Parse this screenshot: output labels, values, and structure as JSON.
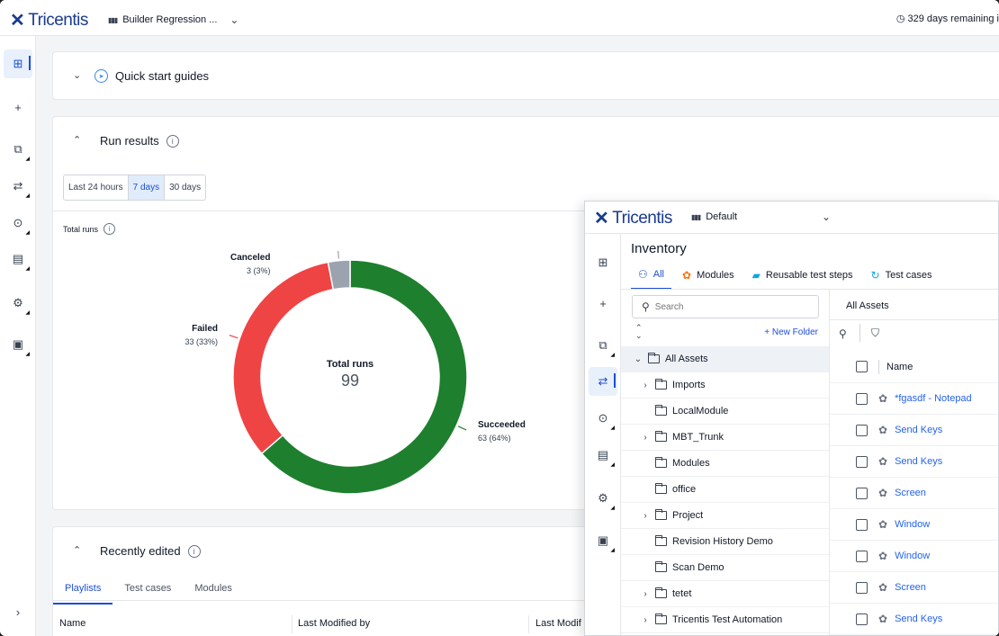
{
  "back": {
    "brand": "Tricentis",
    "workspace": "Builder Regression ...",
    "workspace_icon": "org-icon",
    "remaining": "329 days remaining i",
    "quick_start": "Quick start guides",
    "run_results": {
      "title": "Run results",
      "ranges": [
        "Last 24 hours",
        "7 days",
        "30 days"
      ],
      "selected_range": "7 days",
      "total_runs_label": "Total runs"
    },
    "recently_edited": {
      "title": "Recently edited",
      "tabs": [
        "Playlists",
        "Test cases",
        "Modules"
      ],
      "selected_tab": "Playlists",
      "columns": [
        "Name",
        "Last Modified by",
        "Last Modif"
      ]
    }
  },
  "chart_data": {
    "type": "pie",
    "variant": "donut",
    "center_title": "Total runs",
    "center_value": "99",
    "slices": [
      {
        "label": "Succeeded",
        "value": 63,
        "percent": "63 (64%)",
        "color": "#1e7f2e"
      },
      {
        "label": "Failed",
        "value": 33,
        "percent": "33 (33%)",
        "color": "#ef4444"
      },
      {
        "label": "Canceled",
        "value": 3,
        "percent": "3 (3%)",
        "color": "#9ca3af"
      }
    ]
  },
  "front": {
    "brand": "Tricentis",
    "workspace": "Default",
    "title": "Inventory",
    "categories": [
      {
        "label": "All",
        "icon": "all-assets-icon",
        "color": "#1d4ed8"
      },
      {
        "label": "Modules",
        "icon": "module-icon",
        "color": "#f97316"
      },
      {
        "label": "Reusable test steps",
        "icon": "folder-icon",
        "color": "#0ea5e9"
      },
      {
        "label": "Test cases",
        "icon": "refresh-icon",
        "color": "#0ea5e9"
      }
    ],
    "search_placeholder": "Search",
    "new_folder": "+ New Folder",
    "tree": [
      {
        "label": "All Assets",
        "expander": "down",
        "root": true
      },
      {
        "label": "Imports",
        "expander": "right"
      },
      {
        "label": "LocalModule",
        "expander": ""
      },
      {
        "label": "MBT_Trunk",
        "expander": "right"
      },
      {
        "label": "Modules",
        "expander": ""
      },
      {
        "label": "office",
        "expander": ""
      },
      {
        "label": "Project",
        "expander": "right"
      },
      {
        "label": "Revision History Demo",
        "expander": ""
      },
      {
        "label": "Scan Demo",
        "expander": ""
      },
      {
        "label": "tetet",
        "expander": "right"
      },
      {
        "label": "Tricentis Test Automation",
        "expander": "right"
      }
    ],
    "list_title": "All Assets",
    "list_col": "Name",
    "items": [
      "*fgasdf - Notepad",
      "Send Keys",
      "Send Keys",
      "Screen",
      "Window",
      "Window",
      "Screen",
      "Send Keys"
    ]
  }
}
